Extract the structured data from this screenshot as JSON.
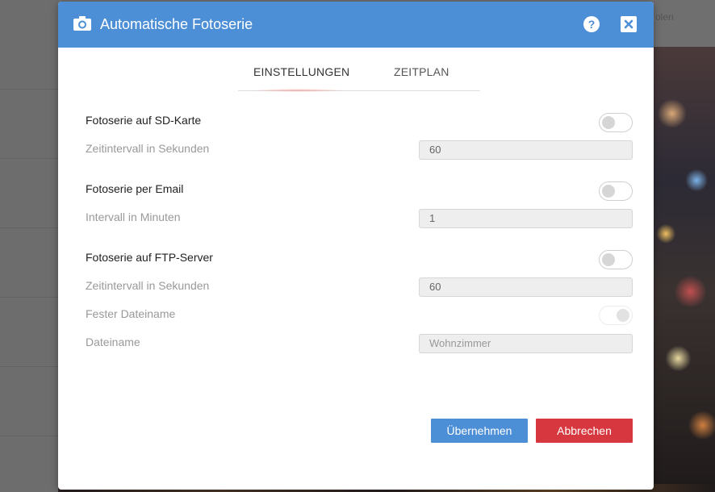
{
  "background": {
    "top_right_text": "olen"
  },
  "dialog": {
    "title": "Automatische Fotoserie",
    "header_color": "#4d8fd6",
    "icons": {
      "camera": "camera-icon",
      "help": "help-icon",
      "close": "close-icon"
    },
    "help_glyph": "?",
    "tabs": [
      {
        "label": "EINSTELLUNGEN",
        "active": true
      },
      {
        "label": "ZEITPLAN",
        "active": false
      }
    ],
    "sd_card": {
      "label": "Fotoserie auf SD-Karte",
      "enabled": false,
      "interval_label": "Zeitintervall in Sekunden",
      "interval_value": "60"
    },
    "email": {
      "label": "Fotoserie per Email",
      "enabled": false,
      "interval_label": "Intervall in Minuten",
      "interval_value": "1"
    },
    "ftp": {
      "label": "Fotoserie auf FTP-Server",
      "enabled": false,
      "interval_label": "Zeitintervall in Sekunden",
      "interval_value": "60",
      "fixed_filename_label": "Fester Dateiname",
      "fixed_filename_enabled": true,
      "filename_label": "Dateiname",
      "filename_placeholder": "Wohnzimmer"
    },
    "buttons": {
      "apply": "Übernehmen",
      "cancel": "Abbrechen",
      "apply_color": "#4d8fd6",
      "cancel_color": "#d7383f"
    }
  }
}
